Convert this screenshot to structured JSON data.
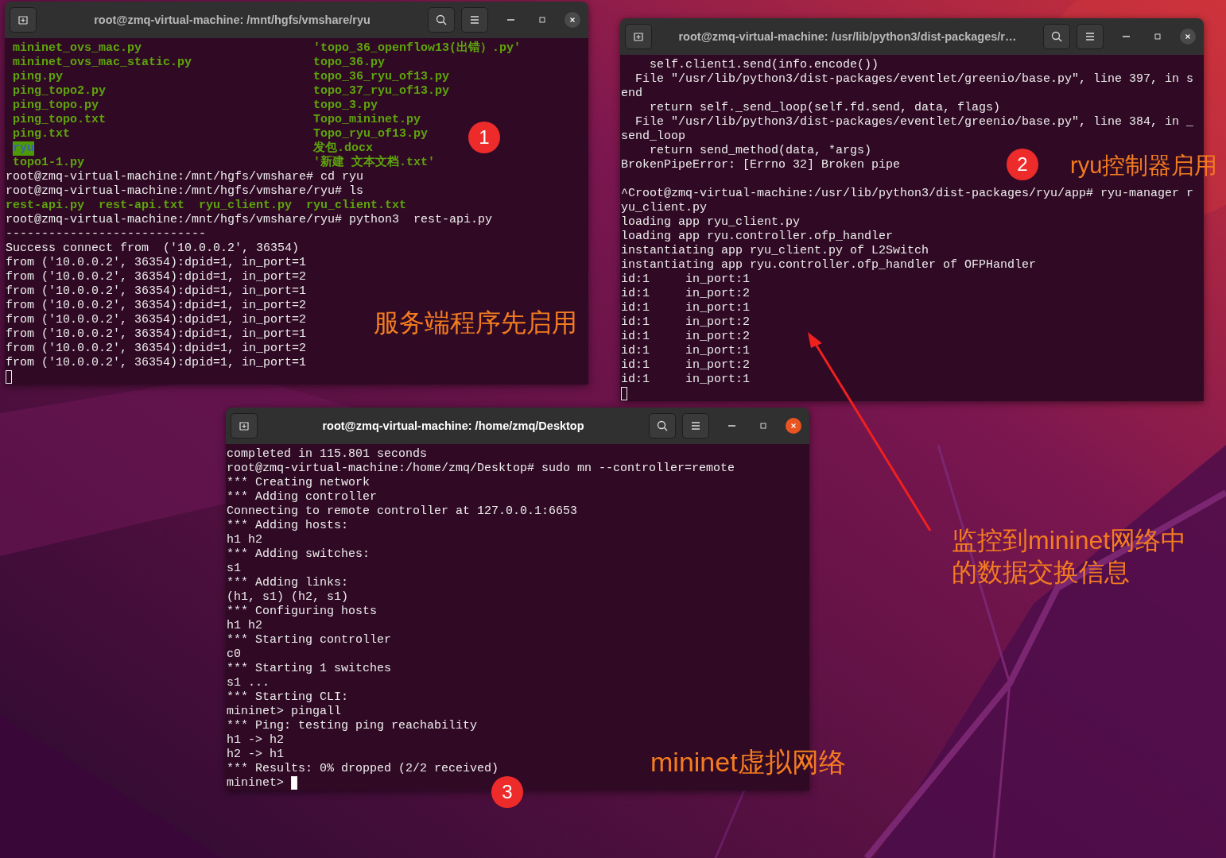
{
  "windows": [
    {
      "title": "root@zmq-virtual-machine: /mnt/hgfs/vmshare/ryu",
      "active": false,
      "lines": [
        {
          "kind": "ls",
          "cells": [
            {
              "text": "mininet_ovs_mac.py",
              "highlight": false
            },
            {
              "text": "'topo_36_openflow13(出错）.py'",
              "highlight": false
            }
          ]
        },
        {
          "kind": "ls",
          "cells": [
            {
              "text": "mininet_ovs_mac_static.py",
              "highlight": false
            },
            {
              "text": "topo_36.py",
              "highlight": false
            }
          ]
        },
        {
          "kind": "ls",
          "cells": [
            {
              "text": "ping.py",
              "highlight": false
            },
            {
              "text": "topo_36_ryu_of13.py",
              "highlight": false
            }
          ]
        },
        {
          "kind": "ls",
          "cells": [
            {
              "text": "ping_topo2.py",
              "highlight": false
            },
            {
              "text": "topo_37_ryu_of13.py",
              "highlight": false
            }
          ]
        },
        {
          "kind": "ls",
          "cells": [
            {
              "text": "ping_topo.py",
              "highlight": false
            },
            {
              "text": "topo_3.py",
              "highlight": false
            }
          ]
        },
        {
          "kind": "ls",
          "cells": [
            {
              "text": "ping_topo.txt",
              "highlight": false
            },
            {
              "text": "Topo_mininet.py",
              "highlight": false
            }
          ]
        },
        {
          "kind": "ls",
          "cells": [
            {
              "text": "ping.txt",
              "highlight": false
            },
            {
              "text": "Topo_ryu_of13.py",
              "highlight": false
            }
          ]
        },
        {
          "kind": "ls",
          "cells": [
            {
              "text": "ryu",
              "highlight": true
            },
            {
              "text": "发包.docx",
              "highlight": false
            }
          ]
        },
        {
          "kind": "ls",
          "cells": [
            {
              "text": "topo1-1.py",
              "highlight": false
            },
            {
              "text": "'新建 文本文档.txt'",
              "highlight": false
            }
          ]
        },
        {
          "kind": "text",
          "text": "root@zmq-virtual-machine:/mnt/hgfs/vmshare# cd ryu"
        },
        {
          "kind": "text",
          "text": "root@zmq-virtual-machine:/mnt/hgfs/vmshare/ryu# ls"
        },
        {
          "kind": "green",
          "text": "rest-api.py  rest-api.txt  ryu_client.py  ryu_client.txt"
        },
        {
          "kind": "text",
          "text": "root@zmq-virtual-machine:/mnt/hgfs/vmshare/ryu# python3  rest-api.py"
        },
        {
          "kind": "text",
          "text": "----------------------------"
        },
        {
          "kind": "text",
          "text": "Success connect from  ('10.0.0.2', 36354)"
        },
        {
          "kind": "text",
          "text": "from ('10.0.0.2', 36354):dpid=1, in_port=1"
        },
        {
          "kind": "text",
          "text": "from ('10.0.0.2', 36354):dpid=1, in_port=2"
        },
        {
          "kind": "text",
          "text": "from ('10.0.0.2', 36354):dpid=1, in_port=1"
        },
        {
          "kind": "text",
          "text": "from ('10.0.0.2', 36354):dpid=1, in_port=2"
        },
        {
          "kind": "text",
          "text": "from ('10.0.0.2', 36354):dpid=1, in_port=2"
        },
        {
          "kind": "text",
          "text": "from ('10.0.0.2', 36354):dpid=1, in_port=1"
        },
        {
          "kind": "text",
          "text": "from ('10.0.0.2', 36354):dpid=1, in_port=2"
        },
        {
          "kind": "text",
          "text": "from ('10.0.0.2', 36354):dpid=1, in_port=1"
        },
        {
          "kind": "cursor"
        }
      ]
    },
    {
      "title": "root@zmq-virtual-machine: /usr/lib/python3/dist-packages/r…",
      "active": false,
      "lines": [
        {
          "kind": "text",
          "text": "    self.client1.send(info.encode())"
        },
        {
          "kind": "text",
          "text": "  File \"/usr/lib/python3/dist-packages/eventlet/greenio/base.py\", line 397, in s"
        },
        {
          "kind": "text",
          "text": "end"
        },
        {
          "kind": "text",
          "text": "    return self._send_loop(self.fd.send, data, flags)"
        },
        {
          "kind": "text",
          "text": "  File \"/usr/lib/python3/dist-packages/eventlet/greenio/base.py\", line 384, in _"
        },
        {
          "kind": "text",
          "text": "send_loop"
        },
        {
          "kind": "text",
          "text": "    return send_method(data, *args)"
        },
        {
          "kind": "text",
          "text": "BrokenPipeError: [Errno 32] Broken pipe"
        },
        {
          "kind": "blank"
        },
        {
          "kind": "text",
          "text": "^Croot@zmq-virtual-machine:/usr/lib/python3/dist-packages/ryu/app# ryu-manager r"
        },
        {
          "kind": "text",
          "text": "yu_client.py"
        },
        {
          "kind": "text",
          "text": "loading app ryu_client.py"
        },
        {
          "kind": "text",
          "text": "loading app ryu.controller.ofp_handler"
        },
        {
          "kind": "text",
          "text": "instantiating app ryu_client.py of L2Switch"
        },
        {
          "kind": "text",
          "text": "instantiating app ryu.controller.ofp_handler of OFPHandler"
        },
        {
          "kind": "text",
          "text": "id:1     in_port:1"
        },
        {
          "kind": "text",
          "text": "id:1     in_port:2"
        },
        {
          "kind": "text",
          "text": "id:1     in_port:1"
        },
        {
          "kind": "text",
          "text": "id:1     in_port:2"
        },
        {
          "kind": "text",
          "text": "id:1     in_port:2"
        },
        {
          "kind": "text",
          "text": "id:1     in_port:1"
        },
        {
          "kind": "text",
          "text": "id:1     in_port:2"
        },
        {
          "kind": "text",
          "text": "id:1     in_port:1"
        },
        {
          "kind": "cursor"
        }
      ]
    },
    {
      "title": "root@zmq-virtual-machine: /home/zmq/Desktop",
      "active": true,
      "lines": [
        {
          "kind": "text",
          "text": "completed in 115.801 seconds"
        },
        {
          "kind": "text",
          "text": "root@zmq-virtual-machine:/home/zmq/Desktop# sudo mn --controller=remote"
        },
        {
          "kind": "text",
          "text": "*** Creating network"
        },
        {
          "kind": "text",
          "text": "*** Adding controller"
        },
        {
          "kind": "text",
          "text": "Connecting to remote controller at 127.0.0.1:6653"
        },
        {
          "kind": "text",
          "text": "*** Adding hosts:"
        },
        {
          "kind": "text",
          "text": "h1 h2"
        },
        {
          "kind": "text",
          "text": "*** Adding switches:"
        },
        {
          "kind": "text",
          "text": "s1"
        },
        {
          "kind": "text",
          "text": "*** Adding links:"
        },
        {
          "kind": "text",
          "text": "(h1, s1) (h2, s1)"
        },
        {
          "kind": "text",
          "text": "*** Configuring hosts"
        },
        {
          "kind": "text",
          "text": "h1 h2"
        },
        {
          "kind": "text",
          "text": "*** Starting controller"
        },
        {
          "kind": "text",
          "text": "c0"
        },
        {
          "kind": "text",
          "text": "*** Starting 1 switches"
        },
        {
          "kind": "text",
          "text": "s1 ..."
        },
        {
          "kind": "text",
          "text": "*** Starting CLI:"
        },
        {
          "kind": "text",
          "text": "mininet> pingall"
        },
        {
          "kind": "text",
          "text": "*** Ping: testing ping reachability"
        },
        {
          "kind": "text",
          "text": "h1 -> h2"
        },
        {
          "kind": "text",
          "text": "h2 -> h1"
        },
        {
          "kind": "text",
          "text": "*** Results: 0% dropped (2/2 received)"
        },
        {
          "kind": "prompt",
          "text": "mininet>"
        }
      ]
    }
  ],
  "badges": [
    "1",
    "2",
    "3"
  ],
  "notes": [
    "服务端程序先启用",
    "ryu控制器启用",
    "监控到mininet网络中的数据交换信息",
    "mininet虚拟网络"
  ]
}
